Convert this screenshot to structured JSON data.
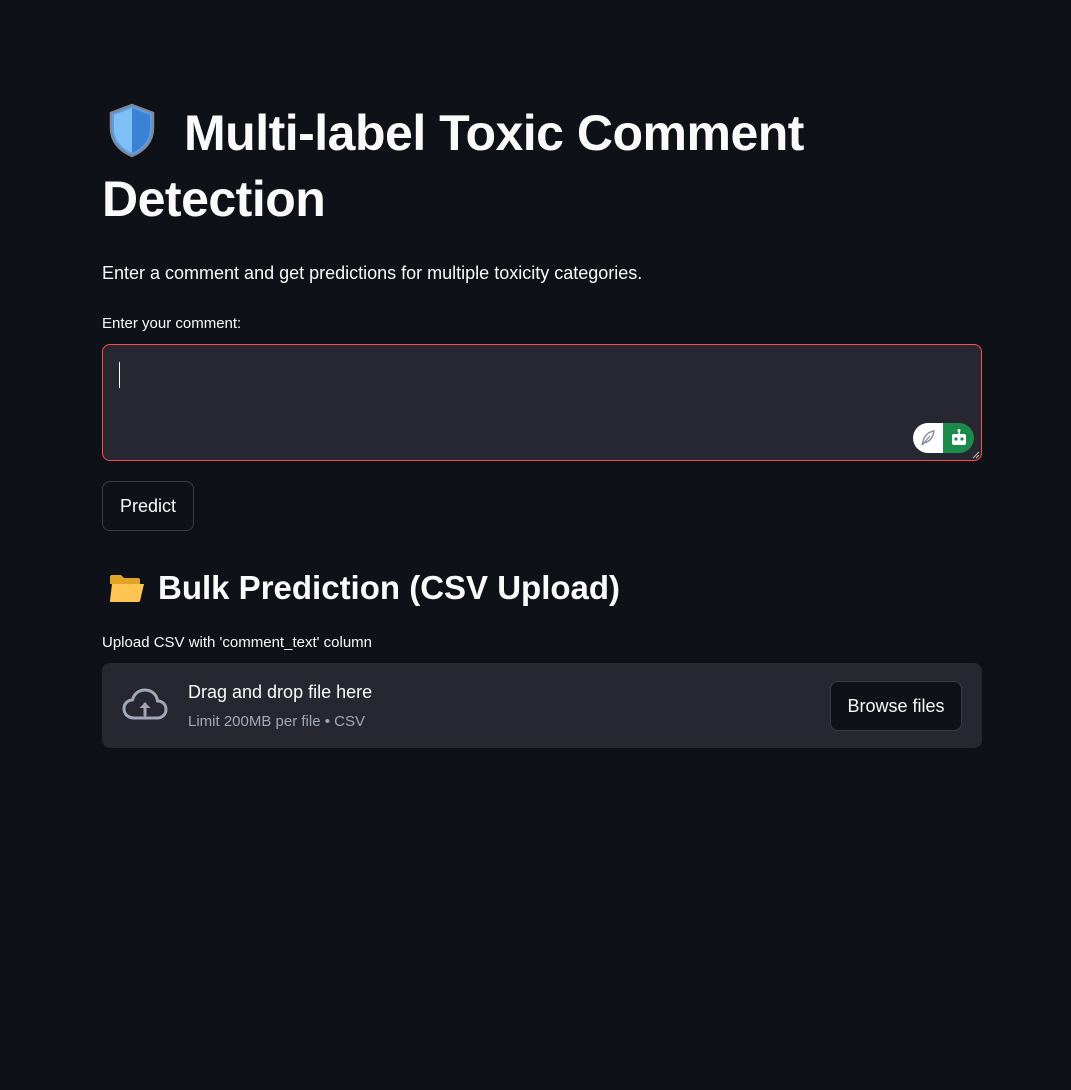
{
  "app": {
    "title": "Multi-label Toxic Comment Detection",
    "title_icon": "shield-icon",
    "subtitle": "Enter a comment and get predictions for multiple toxicity categories."
  },
  "comment_form": {
    "label": "Enter your comment:",
    "value": "",
    "placeholder": "",
    "extension_icons": [
      "feather-icon",
      "robot-icon"
    ],
    "predict_label": "Predict"
  },
  "bulk": {
    "section_icon": "folder-icon",
    "section_title": "Bulk Prediction (CSV Upload)",
    "upload_label": "Upload CSV with 'comment_text' column",
    "drop_title": "Drag and drop file here",
    "drop_hint": "Limit 200MB per file • CSV",
    "upload_icon": "cloud-upload-icon",
    "browse_label": "Browse files"
  },
  "colors": {
    "background": "#0e1117",
    "surface": "#262730",
    "focus_border": "#ff4b4b",
    "text": "#fafafa",
    "muted_text": "#a3a8b8",
    "extension_green": "#1b8a4b"
  }
}
